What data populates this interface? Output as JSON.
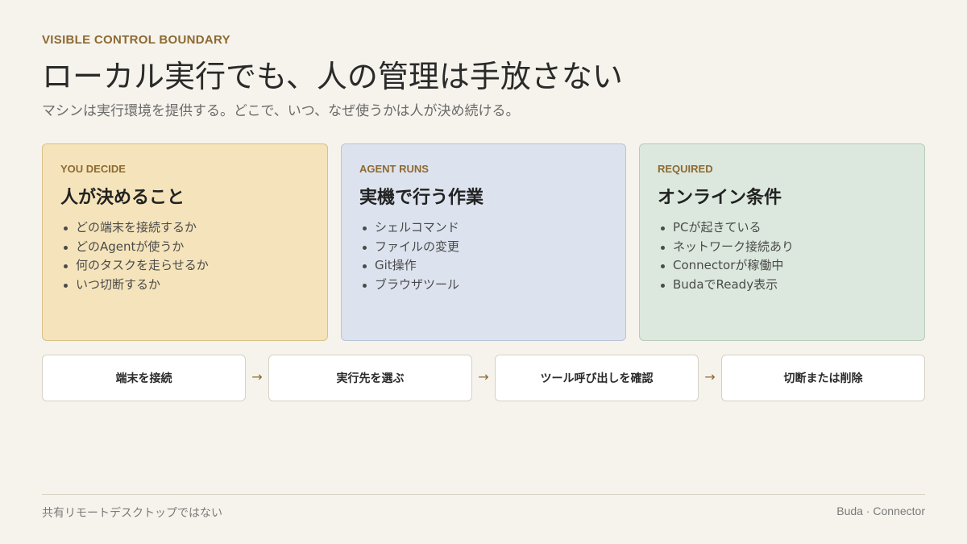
{
  "header": {
    "eyebrow": "VISIBLE CONTROL BOUNDARY",
    "title": "ローカル実行でも、人の管理は手放さない",
    "subtitle": "マシンは実行環境を提供する。どこで、いつ、なぜ使うかは人が決め続ける。"
  },
  "cards": [
    {
      "tag": "YOU DECIDE",
      "heading": "人が決めること",
      "items": [
        "どの端末を接続するか",
        "どのAgentが使うか",
        "何のタスクを走らせるか",
        "いつ切断するか"
      ],
      "background": "#f5e4bb"
    },
    {
      "tag": "AGENT RUNS",
      "heading": "実機で行う作業",
      "items": [
        "シェルコマンド",
        "ファイルの変更",
        "Git操作",
        "ブラウザツール"
      ],
      "background": "#dde3ee"
    },
    {
      "tag": "REQUIRED",
      "heading": "オンライン条件",
      "items": [
        "PCが起きている",
        "ネットワーク接続あり",
        "Connectorが稼働中",
        "BudaでReady表示"
      ],
      "background": "#dce8dd"
    }
  ],
  "steps": [
    "端末を接続",
    "実行先を選ぶ",
    "ツール呼び出しを確認",
    "切断または削除"
  ],
  "arrow_glyph": "→",
  "footer": {
    "left": "共有リモートデスクトップではない",
    "right": "Buda · Connector"
  },
  "colors": {
    "accent": "#8d6a32",
    "background": "#f6f3ec"
  }
}
